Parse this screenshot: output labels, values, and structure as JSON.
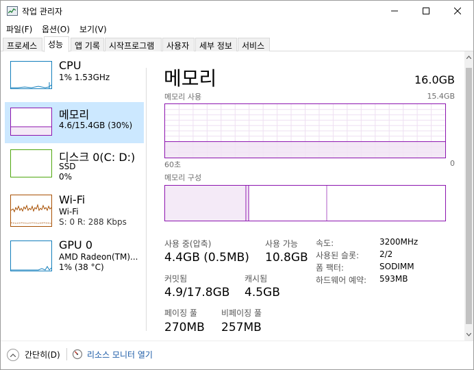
{
  "window": {
    "title": "작업 관리자"
  },
  "menu": {
    "items": [
      "파일(F)",
      "옵션(O)",
      "보기(V)"
    ]
  },
  "tabs": [
    {
      "label": "프로세스",
      "active": false
    },
    {
      "label": "성능",
      "active": true
    },
    {
      "label": "앱 기록",
      "active": false
    },
    {
      "label": "시작프로그램",
      "active": false
    },
    {
      "label": "사용자",
      "active": false
    },
    {
      "label": "세부 정보",
      "active": false
    },
    {
      "label": "서비스",
      "active": false
    }
  ],
  "sidebar": {
    "items": [
      {
        "title": "CPU",
        "line1": "1% 1.53GHz",
        "line2": "",
        "selected": false,
        "color": "#117dbb"
      },
      {
        "title": "메모리",
        "line1": "4.6/15.4GB (30%)",
        "line2": "",
        "selected": true,
        "color": "#8b12ae"
      },
      {
        "title": "디스크 0(C: D:)",
        "line1": "SSD",
        "line2": "0%",
        "selected": false,
        "color": "#4da60c"
      },
      {
        "title": "Wi-Fi",
        "line1": "Wi-Fi",
        "line2": "S: 0 R: 288 Kbps",
        "selected": false,
        "color": "#a74f01"
      },
      {
        "title": "GPU 0",
        "line1": "AMD Radeon(TM)...",
        "line2": "1% (38 °C)",
        "selected": false,
        "color": "#117dbb"
      }
    ]
  },
  "memory": {
    "title": "메모리",
    "total": "16.0GB",
    "usage_label": "메모리 사용",
    "usage_max": "15.4GB",
    "time_left": "60초",
    "time_right": "0",
    "usage_fraction": 0.3,
    "composition_label": "메모리 구성",
    "stats": {
      "in_use_label": "사용 중(압축)",
      "in_use_value": "4.4GB (0.5MB)",
      "available_label": "사용 가능",
      "available_value": "10.8GB",
      "committed_label": "커밋됨",
      "committed_value": "4.9/17.8GB",
      "cached_label": "캐시됨",
      "cached_value": "4.5GB",
      "paged_label": "페이징 풀",
      "paged_value": "270MB",
      "nonpaged_label": "비페이징 풀",
      "nonpaged_value": "257MB"
    },
    "details": [
      {
        "label": "속도:",
        "value": "3200MHz"
      },
      {
        "label": "사용된 슬롯:",
        "value": "2/2"
      },
      {
        "label": "폼 팩터:",
        "value": "SODIMM"
      },
      {
        "label": "하드웨어 예약:",
        "value": "593MB"
      }
    ]
  },
  "footer": {
    "fewer_details": "간단히(D)",
    "open_monitor": "리소스 모니터 열기"
  },
  "colors": {
    "memory_accent": "#8b12ae",
    "selection": "#cce8ff",
    "link": "#1a5aa6"
  }
}
